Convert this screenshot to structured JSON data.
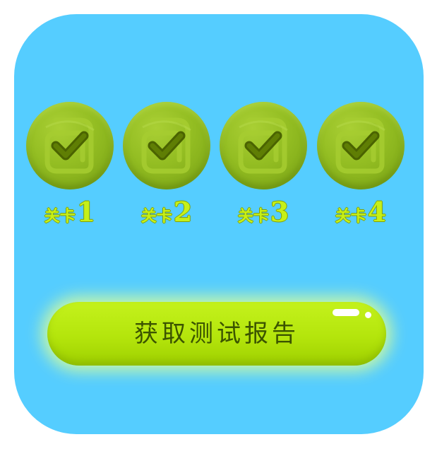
{
  "levels": [
    {
      "prefix": "关卡",
      "number": "1",
      "status": "completed",
      "icon": "checkmark-icon"
    },
    {
      "prefix": "关卡",
      "number": "2",
      "status": "completed",
      "icon": "checkmark-icon"
    },
    {
      "prefix": "关卡",
      "number": "3",
      "status": "completed",
      "icon": "checkmark-icon"
    },
    {
      "prefix": "关卡",
      "number": "4",
      "status": "completed",
      "icon": "checkmark-icon"
    }
  ],
  "report_button": {
    "label": "获取测试报告"
  },
  "colors": {
    "panel": "#55cdff",
    "medal": "#93bd22",
    "label": "#c6f018",
    "button": "#b4e50c",
    "button_text": "#3b5400"
  }
}
